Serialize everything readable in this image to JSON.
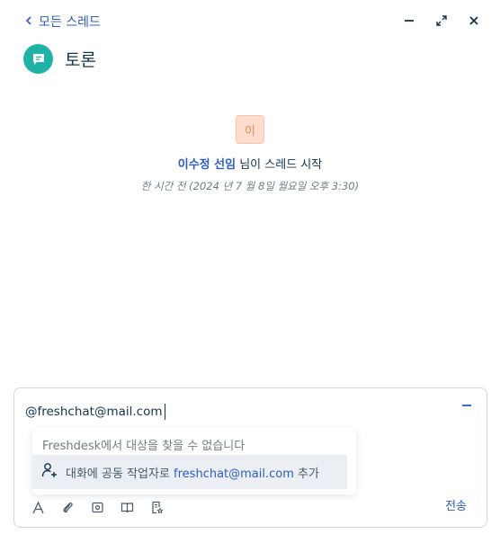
{
  "header": {
    "back_label": "모든 스레드",
    "title": "토론"
  },
  "thread_start": {
    "avatar_initial": "이",
    "author": "이수정 선임",
    "action": " 님이 스레드 시작",
    "timestamp": "한 시간 전 (2024 년 7 월 8일 월요일 오후 3:30)"
  },
  "composer": {
    "text": "@freshchat@mail.com",
    "mention_popup": {
      "not_found": "Freshdesk에서 대상을 찾을 수 없습니다",
      "add_prefix": "대화에 공동 작업자로 ",
      "add_email": "freshchat@mail.com",
      "add_suffix": " 추가"
    },
    "send_label": "전송"
  },
  "colors": {
    "accent": "#2c5cc5",
    "chat_icon_bg": "#1fb3a6",
    "avatar_bg": "#fcdccc",
    "highlight_row": "#ebeff3"
  }
}
